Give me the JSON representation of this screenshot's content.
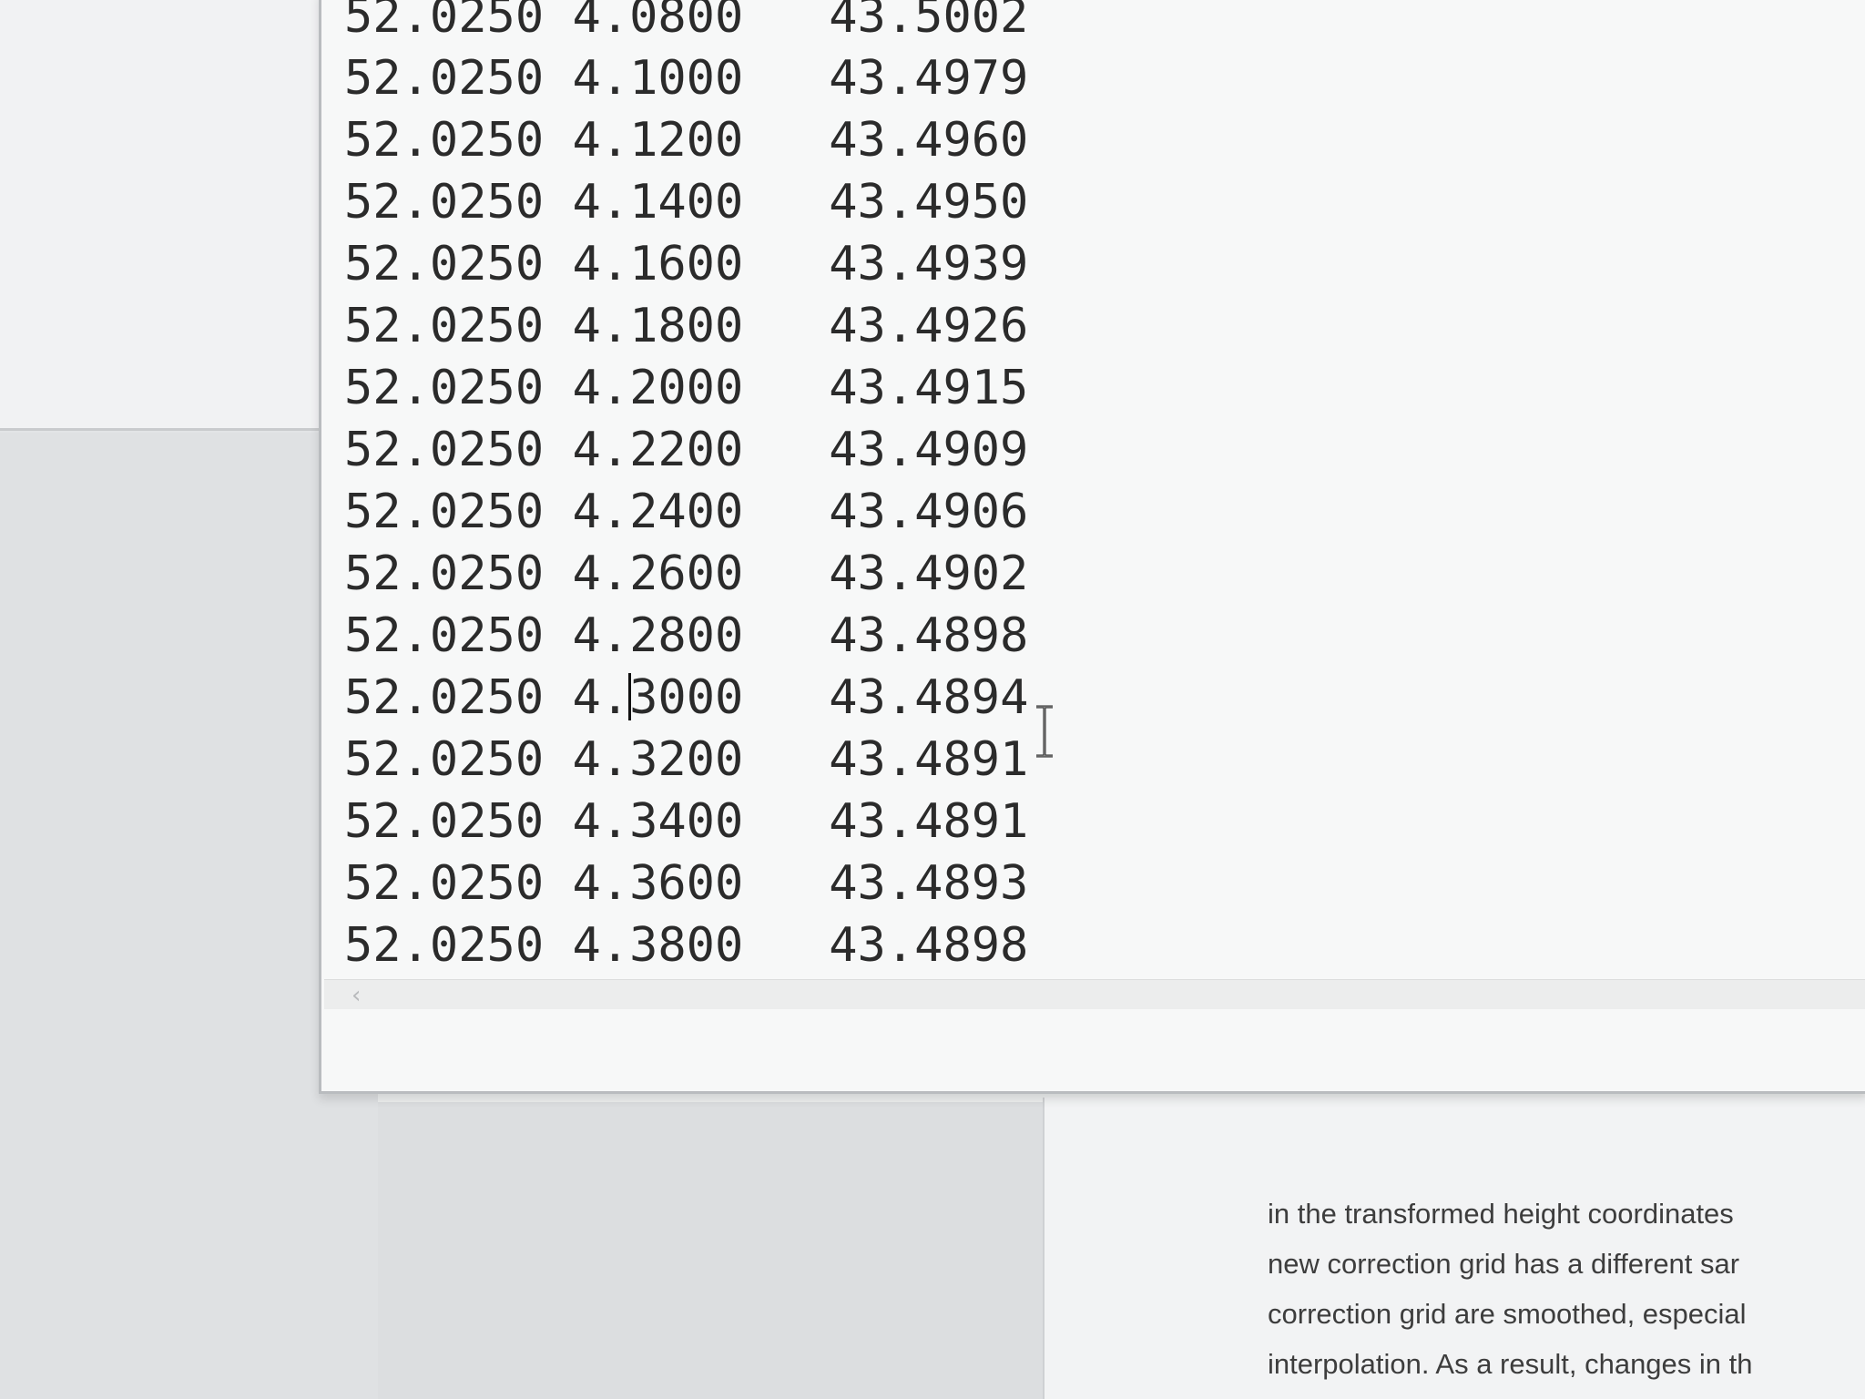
{
  "editor": {
    "lines": [
      "52.0250 4.0800   43.5002",
      "52.0250 4.1000   43.4979",
      "52.0250 4.1200   43.4960",
      "52.0250 4.1400   43.4950",
      "52.0250 4.1600   43.4939",
      "52.0250 4.1800   43.4926",
      "52.0250 4.2000   43.4915",
      "52.0250 4.2200   43.4909",
      "52.0250 4.2400   43.4906",
      "52.0250 4.2600   43.4902",
      "52.0250 4.2800   43.4898",
      "52.0250 4.3000   43.4894",
      "52.0250 4.3200   43.4891",
      "52.0250 4.3400   43.4891",
      "52.0250 4.3600   43.4893",
      "52.0250 4.3800   43.4898"
    ],
    "caret_line": 11,
    "caret_col": 10,
    "scroll_left_icon": "chevron-left-icon"
  },
  "document": {
    "lines": [
      "in the transformed height coordinates",
      "new correction grid has a different sar",
      "correction grid are smoothed, especial",
      "interpolation. As a result, changes in th"
    ]
  },
  "cursor_icon": "text-cursor-icon"
}
